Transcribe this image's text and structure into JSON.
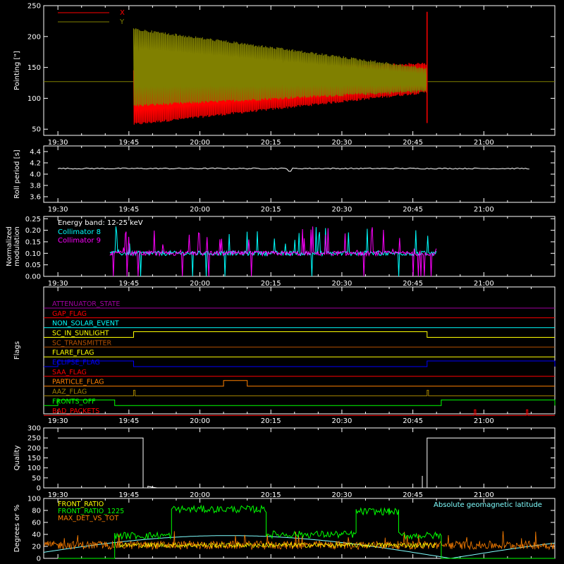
{
  "colors": {
    "background": "#000000",
    "axes": "#ffffff",
    "red": "#ff0000",
    "olive": "#808000",
    "white": "#ffffff",
    "cyan": "#00ffff",
    "magenta": "#ff00ff",
    "orange": "#ff8000",
    "yellow": "#ffff00",
    "blue": "#0000ff",
    "green": "#00ff00",
    "purple": "#a000a0",
    "brown": "#b45000",
    "olive_flag": "#a08000",
    "pale_cyan": "#80ffff"
  },
  "time_ticks": [
    "19:30",
    "19:45",
    "20:00",
    "20:15",
    "20:30",
    "20:45",
    "21:00"
  ],
  "chart_data": [
    {
      "id": "pointing",
      "type": "line",
      "ylabel": "Pointing [\"]",
      "ylim": [
        40,
        250
      ],
      "yticks": [
        "50",
        "100",
        "150",
        "200",
        "250"
      ],
      "legend": [
        "X",
        "Y"
      ],
      "legend_position": "top-left",
      "series": [
        {
          "name": "X",
          "color": "red",
          "baseline": 127,
          "oscillation": {
            "start": "19:46",
            "end": "20:48",
            "start_range": [
              56,
              148
            ],
            "end_range": [
              108,
              158
            ]
          }
        },
        {
          "name": "Y",
          "color": "olive",
          "baseline": 127,
          "oscillation": {
            "start": "19:46",
            "end": "20:48",
            "start_range": [
              86,
              214
            ],
            "end_range": [
              110,
              150
            ]
          }
        }
      ]
    },
    {
      "id": "roll_period",
      "type": "line",
      "ylabel": "Roll period [s]",
      "ylim": [
        3.5,
        4.5
      ],
      "yticks": [
        "3.6",
        "3.8",
        "4.0",
        "4.2",
        "4.4"
      ],
      "series": [
        {
          "color": "white",
          "value": 4.1,
          "range": [
            "19:30",
            "21:10"
          ]
        }
      ]
    },
    {
      "id": "modulation",
      "type": "line",
      "ylabel": "Normalized modulation",
      "ylim": [
        0,
        0.26
      ],
      "yticks": [
        "0.00",
        "0.05",
        "0.10",
        "0.15",
        "0.20",
        "0.25"
      ],
      "annotation": "Energy band: 12-25 keV",
      "legend": [
        "Collimator 8",
        "Collimator 9"
      ],
      "series": [
        {
          "name": "Collimator 8",
          "color": "cyan",
          "start": "19:41",
          "end": "20:50",
          "level": 0.09
        },
        {
          "name": "Collimator 9",
          "color": "magenta",
          "start": "19:41",
          "end": "20:50",
          "level": 0.09
        }
      ]
    },
    {
      "id": "flags",
      "type": "line",
      "ylabel": "Flags",
      "flags": [
        {
          "name": "ATTENUATOR_STATE",
          "color": "purple",
          "segments": []
        },
        {
          "name": "GAP_FLAG",
          "color": "red",
          "segments": []
        },
        {
          "name": "NON_SOLAR_EVENT",
          "color": "cyan",
          "segments": []
        },
        {
          "name": "SC_IN_SUNLIGHT",
          "color": "yellow",
          "segments": [
            [
              "19:46",
              "20:48"
            ]
          ]
        },
        {
          "name": "SC_TRANSMITTER",
          "color": "brown",
          "segments": []
        },
        {
          "name": "FLARE_FLAG",
          "color": "yellow",
          "segments": []
        },
        {
          "name": "ECLIPSE_FLAG",
          "color": "blue",
          "segments": [
            [
              "19:30",
              "19:46"
            ],
            [
              "20:48",
              "21:15"
            ]
          ]
        },
        {
          "name": "SAA_FLAG",
          "color": "red",
          "segments": []
        },
        {
          "name": "PARTICLE_FLAG",
          "color": "orange",
          "segments": [
            [
              "20:05",
              "20:10"
            ]
          ]
        },
        {
          "name": "AAZ_FLAG",
          "color": "olive_flag",
          "segments": [
            [
              "19:46",
              "19:46"
            ],
            [
              "20:48",
              "20:48"
            ]
          ]
        },
        {
          "name": "FRONTS_OFF",
          "color": "green",
          "segments": [
            [
              "19:30",
              "19:42"
            ],
            [
              "20:51",
              "21:15"
            ]
          ]
        },
        {
          "name": "BAD_PACKETS",
          "color": "red",
          "segments": [
            [
              "20:58",
              "20:58"
            ],
            [
              "21:09",
              "21:09"
            ]
          ]
        }
      ]
    },
    {
      "id": "quality",
      "type": "line",
      "ylabel": "Quality",
      "ylim": [
        0,
        300
      ],
      "yticks": [
        "0",
        "50",
        "100",
        "150",
        "200",
        "250",
        "300"
      ],
      "series": [
        {
          "color": "white",
          "steps": [
            [
              "19:30",
              250
            ],
            [
              "19:48",
              0
            ],
            [
              "20:48",
              250
            ],
            [
              "21:15",
              250
            ]
          ]
        }
      ]
    },
    {
      "id": "ratios",
      "type": "line",
      "ylabel": "Degrees or %",
      "ylim": [
        0,
        100
      ],
      "yticks": [
        "0",
        "20",
        "40",
        "60",
        "80",
        "100"
      ],
      "legend": [
        "FRONT_RATIO",
        "FRONT_RATIO_1225",
        "MAX_DET_VS_TOT"
      ],
      "annotation": "Absolute geomagnetic latitude",
      "series": [
        {
          "name": "FRONT_RATIO",
          "color": "yellow"
        },
        {
          "name": "FRONT_RATIO_1225",
          "color": "green",
          "steps": [
            [
              "19:30",
              0
            ],
            [
              "19:42",
              38
            ],
            [
              "19:50",
              38
            ],
            [
              "19:54",
              82
            ],
            [
              "20:12",
              82
            ],
            [
              "20:14",
              40
            ],
            [
              "20:30",
              40
            ],
            [
              "20:33",
              78
            ],
            [
              "20:40",
              78
            ],
            [
              "20:42",
              38
            ],
            [
              "20:50",
              38
            ],
            [
              "20:51",
              0
            ],
            [
              "21:15",
              0
            ]
          ]
        },
        {
          "name": "MAX_DET_VS_TOT",
          "color": "orange",
          "level": 22
        },
        {
          "name": "Absolute geomagnetic latitude",
          "color": "pale_cyan"
        }
      ]
    }
  ]
}
